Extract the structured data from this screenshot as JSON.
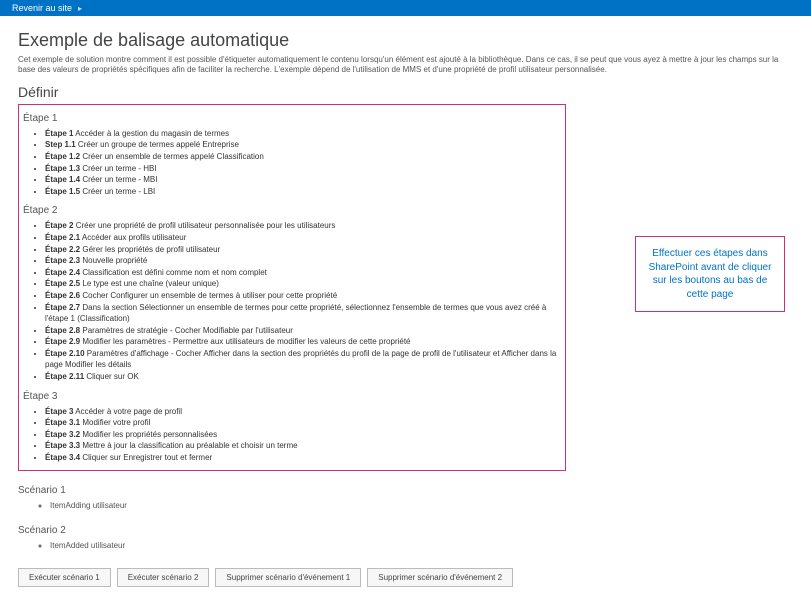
{
  "topbar": {
    "back": "Revenir au site"
  },
  "page": {
    "title": "Exemple de balisage automatique",
    "intro": "Cet exemple de solution montre comment il est possible d'étiqueter automatiquement le contenu lorsqu'un élément est ajouté à la bibliothèque. Dans ce cas, il se peut que vous ayez à mettre à jour les champs sur la base des valeurs de propriétés spécifiques afin de faciliter la recherche. L'exemple dépend de l'utilisation de MMS et d'une propriété de profil utilisateur personnalisée.",
    "definir": "Définir"
  },
  "callout": "Effectuer ces étapes dans SharePoint avant de cliquer sur les boutons au bas de cette page",
  "etapes": {
    "e1": {
      "title": "Étape 1",
      "items": [
        {
          "b": "Étape 1",
          "t": " Accéder à la gestion du magasin de termes"
        },
        {
          "b": "Step 1.1",
          "t": " Créer un groupe de termes appelé Entreprise"
        },
        {
          "b": "Étape 1.2",
          "t": " Créer un ensemble de termes appelé Classification"
        },
        {
          "b": "Étape 1.3",
          "t": " Créer un terme - HBI"
        },
        {
          "b": "Étape 1.4",
          "t": " Créer un terme - MBI"
        },
        {
          "b": "Étape 1.5",
          "t": " Créer un terme - LBI"
        }
      ]
    },
    "e2": {
      "title": "Étape 2",
      "items": [
        {
          "b": "Étape 2",
          "t": " Créer une propriété de profil utilisateur personnalisée pour les utilisateurs"
        },
        {
          "b": "Étape 2.1",
          "t": " Accéder aux profils utilisateur"
        },
        {
          "b": "Étape 2.2",
          "t": " Gérer les propriétés de profil utilisateur"
        },
        {
          "b": "Étape 2.3",
          "t": " Nouvelle propriété"
        },
        {
          "b": "Étape 2.4",
          "t": " Classification est défini comme nom et nom complet"
        },
        {
          "b": "Étape 2.5",
          "t": " Le type est une chaîne (valeur unique)"
        },
        {
          "b": "Étape 2.6",
          "t": " Cocher Configurer un ensemble de termes à utiliser pour cette propriété"
        },
        {
          "b": "Étape 2.7",
          "t": " Dans la section Sélectionner un ensemble de termes pour cette propriété, sélectionnez l'ensemble de termes que vous avez créé à l'étape 1 (Classification)"
        },
        {
          "b": "Étape 2.8",
          "t": " Paramètres de stratégie - Cocher Modifiable par l'utilisateur"
        },
        {
          "b": "Étape 2.9",
          "t": " Modifier les paramètres - Permettre aux utilisateurs de modifier les valeurs de cette propriété"
        },
        {
          "b": "Étape 2.10",
          "t": " Paramètres d'affichage - Cocher Afficher dans la section des propriétés du profil de la page de profil de l'utilisateur et Afficher dans la page Modifier les détails"
        },
        {
          "b": "Étape 2.11",
          "t": " Cliquer sur OK"
        }
      ]
    },
    "e3": {
      "title": "Étape 3",
      "items": [
        {
          "b": "Étape 3",
          "t": " Accéder à votre page de profil"
        },
        {
          "b": "Étape 3.1",
          "t": " Modifier votre profil"
        },
        {
          "b": "Étape 3.2",
          "t": " Modifier les propriétés personnalisées"
        },
        {
          "b": "Étape 3.3",
          "t": " Mettre à jour la classification au préalable et choisir un terme"
        },
        {
          "b": "Étape 3.4",
          "t": " Cliquer sur Enregistrer tout et fermer"
        }
      ]
    }
  },
  "scenarios": {
    "s1": {
      "title": "Scénario 1",
      "item": "ItemAdding utilisateur"
    },
    "s2": {
      "title": "Scénario 2",
      "item": "ItemAdded utilisateur"
    }
  },
  "buttons": {
    "b1": "Exécuter scénario 1",
    "b2": "Exécuter scénario 2",
    "b3": "Supprimer scénario d'événement 1",
    "b4": "Supprimer scénario d'événement 2"
  }
}
